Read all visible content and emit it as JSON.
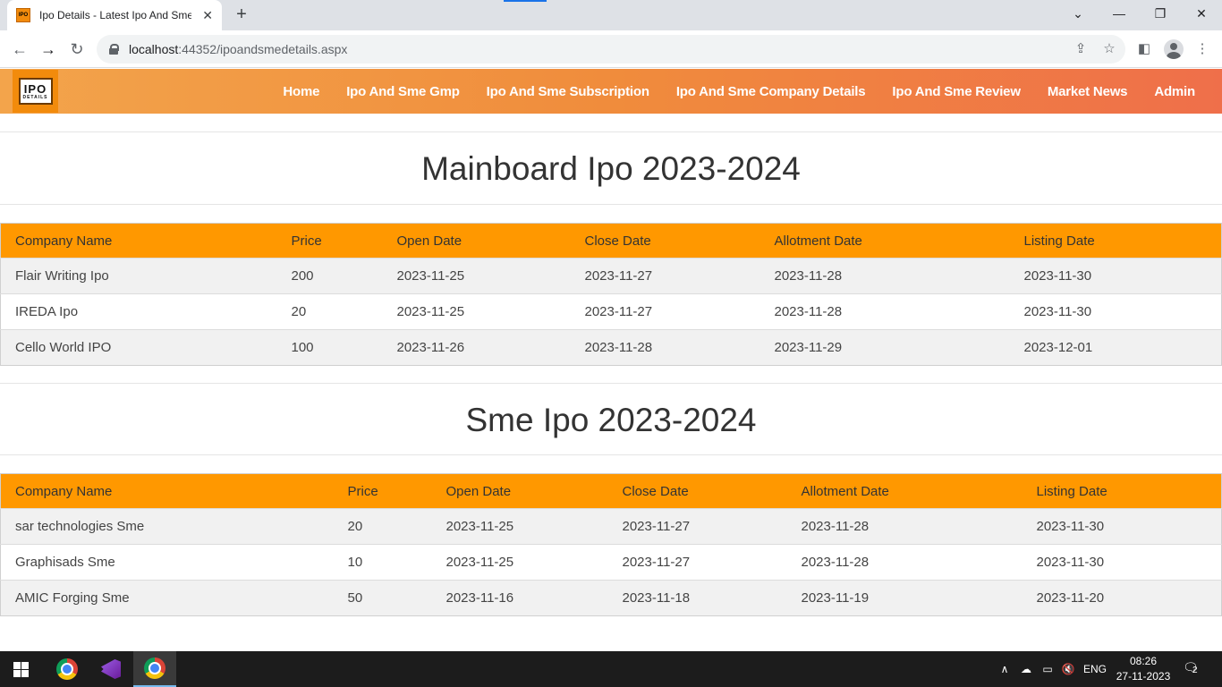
{
  "browser": {
    "tab_title": "Ipo Details - Latest Ipo And Sme",
    "url_host": "localhost",
    "url_rest": ":44352/ipoandsmedetails.aspx"
  },
  "site": {
    "logo_big": "IPO",
    "logo_small": "DETAILS",
    "nav": [
      "Home",
      "Ipo And Sme Gmp",
      "Ipo And Sme Subscription",
      "Ipo And Sme Company Details",
      "Ipo And Sme Review",
      "Market News",
      "Admin"
    ]
  },
  "mainboard": {
    "title": "Mainboard Ipo 2023-2024",
    "headers": [
      "Company Name",
      "Price",
      "Open Date",
      "Close Date",
      "Allotment Date",
      "Listing Date"
    ],
    "rows": [
      [
        "Flair Writing Ipo",
        "200",
        "2023-11-25",
        "2023-11-27",
        "2023-11-28",
        "2023-11-30"
      ],
      [
        "IREDA Ipo",
        "20",
        "2023-11-25",
        "2023-11-27",
        "2023-11-28",
        "2023-11-30"
      ],
      [
        "Cello World IPO",
        "100",
        "2023-11-26",
        "2023-11-28",
        "2023-11-29",
        "2023-12-01"
      ]
    ]
  },
  "sme": {
    "title": "Sme Ipo 2023-2024",
    "headers": [
      "Company Name",
      "Price",
      "Open Date",
      "Close Date",
      "Allotment Date",
      "Listing Date"
    ],
    "rows": [
      [
        "sar technologies Sme",
        "20",
        "2023-11-25",
        "2023-11-27",
        "2023-11-28",
        "2023-11-30"
      ],
      [
        "Graphisads Sme",
        "10",
        "2023-11-25",
        "2023-11-27",
        "2023-11-28",
        "2023-11-30"
      ],
      [
        "AMIC Forging Sme",
        "50",
        "2023-11-16",
        "2023-11-18",
        "2023-11-19",
        "2023-11-20"
      ]
    ]
  },
  "taskbar": {
    "language": "ENG",
    "time": "08:26",
    "date": "27-11-2023",
    "notification_count": "2"
  },
  "colors": {
    "header_gradient_start": "#f3a44b",
    "header_gradient_end": "#ef6f4a",
    "table_header": "#ff9800"
  }
}
